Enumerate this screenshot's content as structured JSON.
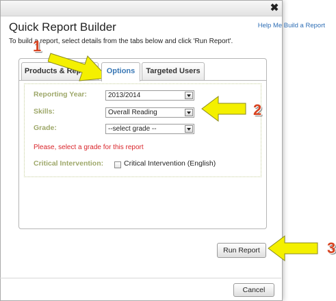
{
  "dialog": {
    "title": "Quick Report Builder",
    "help_link": "Help Me Build a Report",
    "instructions": "To build a report, select details from the tabs below and click 'Run Report'.",
    "close_glyph": "✖"
  },
  "tabs": [
    {
      "label": "Products & Reports",
      "active": false
    },
    {
      "label": "Options",
      "active": true
    },
    {
      "label": "Targeted Users",
      "active": false
    }
  ],
  "form": {
    "reporting_year": {
      "label": "Reporting Year:",
      "value": "2013/2014"
    },
    "skills": {
      "label": "Skills:",
      "value": "Overall Reading"
    },
    "grade": {
      "label": "Grade:",
      "value": "--select grade --"
    },
    "error": "Please, select a grade for this report",
    "critical_intervention": {
      "label": "Critical Intervention:",
      "checkbox_label": "Critical Intervention (English)",
      "checked": false
    }
  },
  "buttons": {
    "run_report": "Run Report",
    "cancel": "Cancel"
  },
  "annotations": [
    {
      "number": "1",
      "color": "#d84422",
      "arrow_color": "#f4f000"
    },
    {
      "number": "2",
      "color": "#d84422",
      "arrow_color": "#f4f000"
    },
    {
      "number": "3",
      "color": "#d84422",
      "arrow_color": "#f4f000"
    }
  ],
  "colors": {
    "accent_tab": "#3a78b5",
    "label": "#9ea86a",
    "error": "#d9252b",
    "link": "#2e6eb5"
  }
}
